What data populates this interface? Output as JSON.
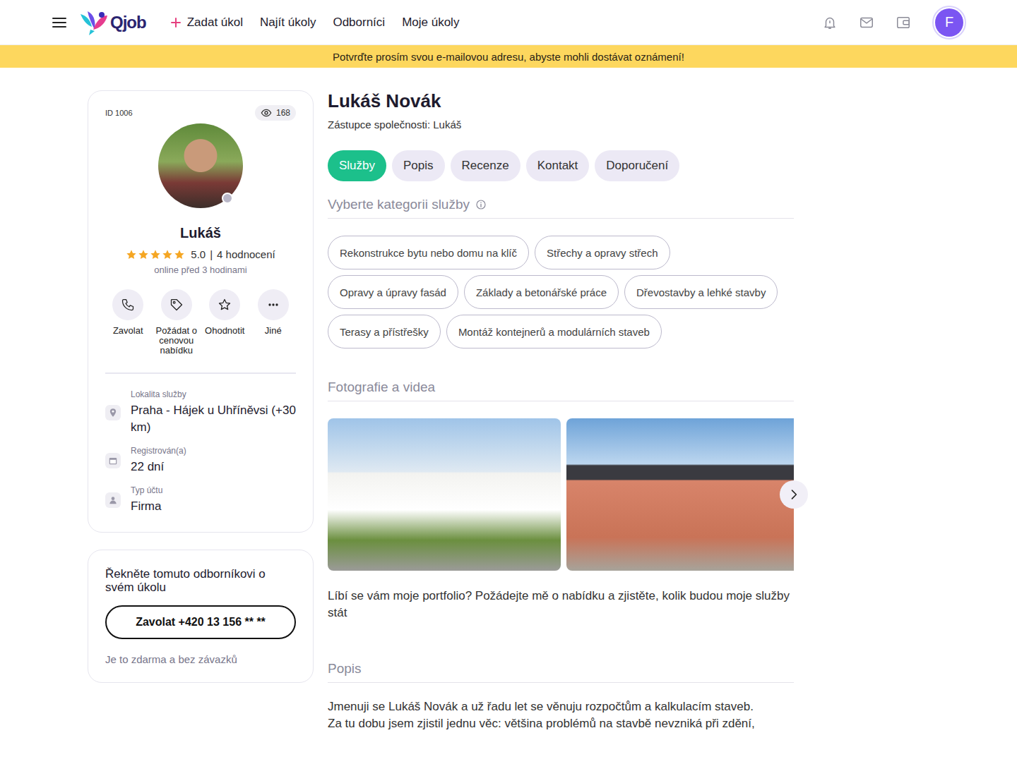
{
  "nav": {
    "logo": "Qjob",
    "links": [
      {
        "label": "Zadat úkol",
        "kind": "add"
      },
      {
        "label": "Najít úkoly",
        "kind": "plain"
      },
      {
        "label": "Odborníci",
        "kind": "plain"
      },
      {
        "label": "Moje úkoly",
        "kind": "plain"
      }
    ],
    "avatar": "F"
  },
  "banner": "Potvrďte prosím svou e-mailovou adresu, abyste mohli dostávat oznámení!",
  "profile": {
    "id": "ID 1006",
    "views": "168",
    "name": "Lukáš",
    "stars": 5,
    "rating": "5.0",
    "separator": "|",
    "reviews": "4 hodnocení",
    "last_online": "online před 3 hodinami",
    "online": false,
    "actions": [
      {
        "label": "Zavolat",
        "kind": "phone"
      },
      {
        "label": "Požádat o cenovou nabídku",
        "kind": "tag"
      },
      {
        "label": "Ohodnotit",
        "kind": "star"
      },
      {
        "label": "Jiné",
        "kind": "more"
      }
    ],
    "info": [
      {
        "label": "Lokalita služby",
        "value": "Praha - Hájek u Uhříněvsi (+30 km)",
        "kind": "location"
      },
      {
        "label": "Registrován(a)",
        "value": "22 dní",
        "kind": "calendar"
      },
      {
        "label": "Typ účtu",
        "value": "Firma",
        "kind": "user"
      }
    ]
  },
  "call_card": {
    "title": "Řekněte tomuto odborníkovi o svém úkolu",
    "button": "Zavolat +420 13 156 ** **",
    "note": "Je to zdarma a bez závazků"
  },
  "main": {
    "title": "Lukáš Novák",
    "subtitle": "Zástupce společnosti: Lukáš",
    "tabs": [
      {
        "label": "Služby",
        "selected": true
      },
      {
        "label": "Popis",
        "selected": false
      },
      {
        "label": "Recenze",
        "selected": false
      },
      {
        "label": "Kontakt",
        "selected": false
      },
      {
        "label": "Doporučení",
        "selected": false
      }
    ],
    "categories_title": "Vyberte kategorii služby",
    "categories": [
      "Rekonstrukce bytu nebo domu na klíč",
      "Střechy a opravy střech",
      "Opravy a úpravy fasád",
      "Základy a betonářské práce",
      "Dřevostavby a lehké stavby",
      "Terasy a přístřešky",
      "Montáž kontejnerů a modulárních staveb"
    ],
    "media_title": "Fotografie a videa",
    "photos": 2,
    "portfolio_text": "Líbí se vám moje portfolio? Požádejte mě o nabídku a zjistěte, kolik budou moje služby stát",
    "description_title": "Popis",
    "description": [
      "Jmenuji se Lukáš Novák a už řadu let se věnuju rozpočtům a kalkulacím staveb.",
      "Za tu dobu jsem zjistil jednu věc: většina problémů na stavbě nevzniká při zdění,"
    ]
  }
}
